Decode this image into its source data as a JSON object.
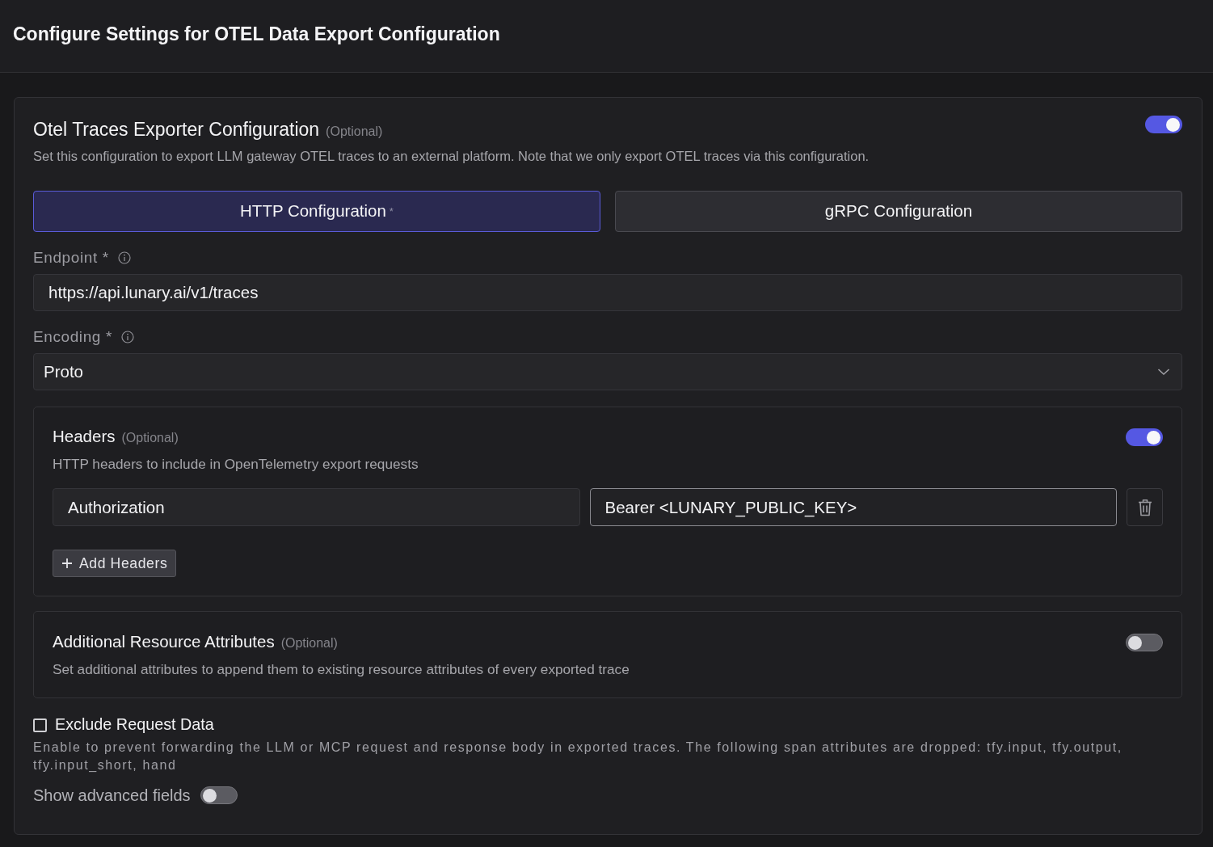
{
  "page": {
    "title": "Configure Settings for OTEL Data Export Configuration"
  },
  "exporter": {
    "title": "Otel Traces Exporter Configuration",
    "optional_label": "(Optional)",
    "enabled": true,
    "description": "Set this configuration to export LLM gateway OTEL traces to an external platform. Note that we only export OTEL traces via this configuration.",
    "tabs": [
      {
        "label": "HTTP Configuration",
        "required_mark": "*",
        "selected": true
      },
      {
        "label": "gRPC Configuration",
        "selected": false
      }
    ],
    "fields": [
      {
        "kind": "text",
        "label": "Endpoint",
        "required_mark": "*",
        "value": "https://api.lunary.ai/v1/traces"
      },
      {
        "kind": "select",
        "label": "Encoding",
        "required_mark": "*",
        "value": "Proto"
      }
    ],
    "panels": [
      {
        "title": "Headers",
        "optional_label": "(Optional)",
        "enabled": true,
        "description": "HTTP headers to include in OpenTelemetry export requests",
        "rows": [
          {
            "key": "Authorization",
            "value": "Bearer <LUNARY_PUBLIC_KEY>",
            "value_focused": true
          }
        ],
        "add_button": "Add Headers"
      },
      {
        "title": "Additional Resource Attributes",
        "optional_label": "(Optional)",
        "enabled": false,
        "description": "Set additional attributes to append them to existing resource attributes of every exported trace"
      }
    ],
    "exclude_request_data": {
      "label": "Exclude Request Data",
      "checked": false,
      "description": "Enable to prevent forwarding the LLM or MCP request and response body in exported traces. The following span attributes are dropped: tfy.input, tfy.output, tfy.input_short, hand"
    },
    "advanced": {
      "label": "Show advanced fields",
      "on": false
    }
  }
}
